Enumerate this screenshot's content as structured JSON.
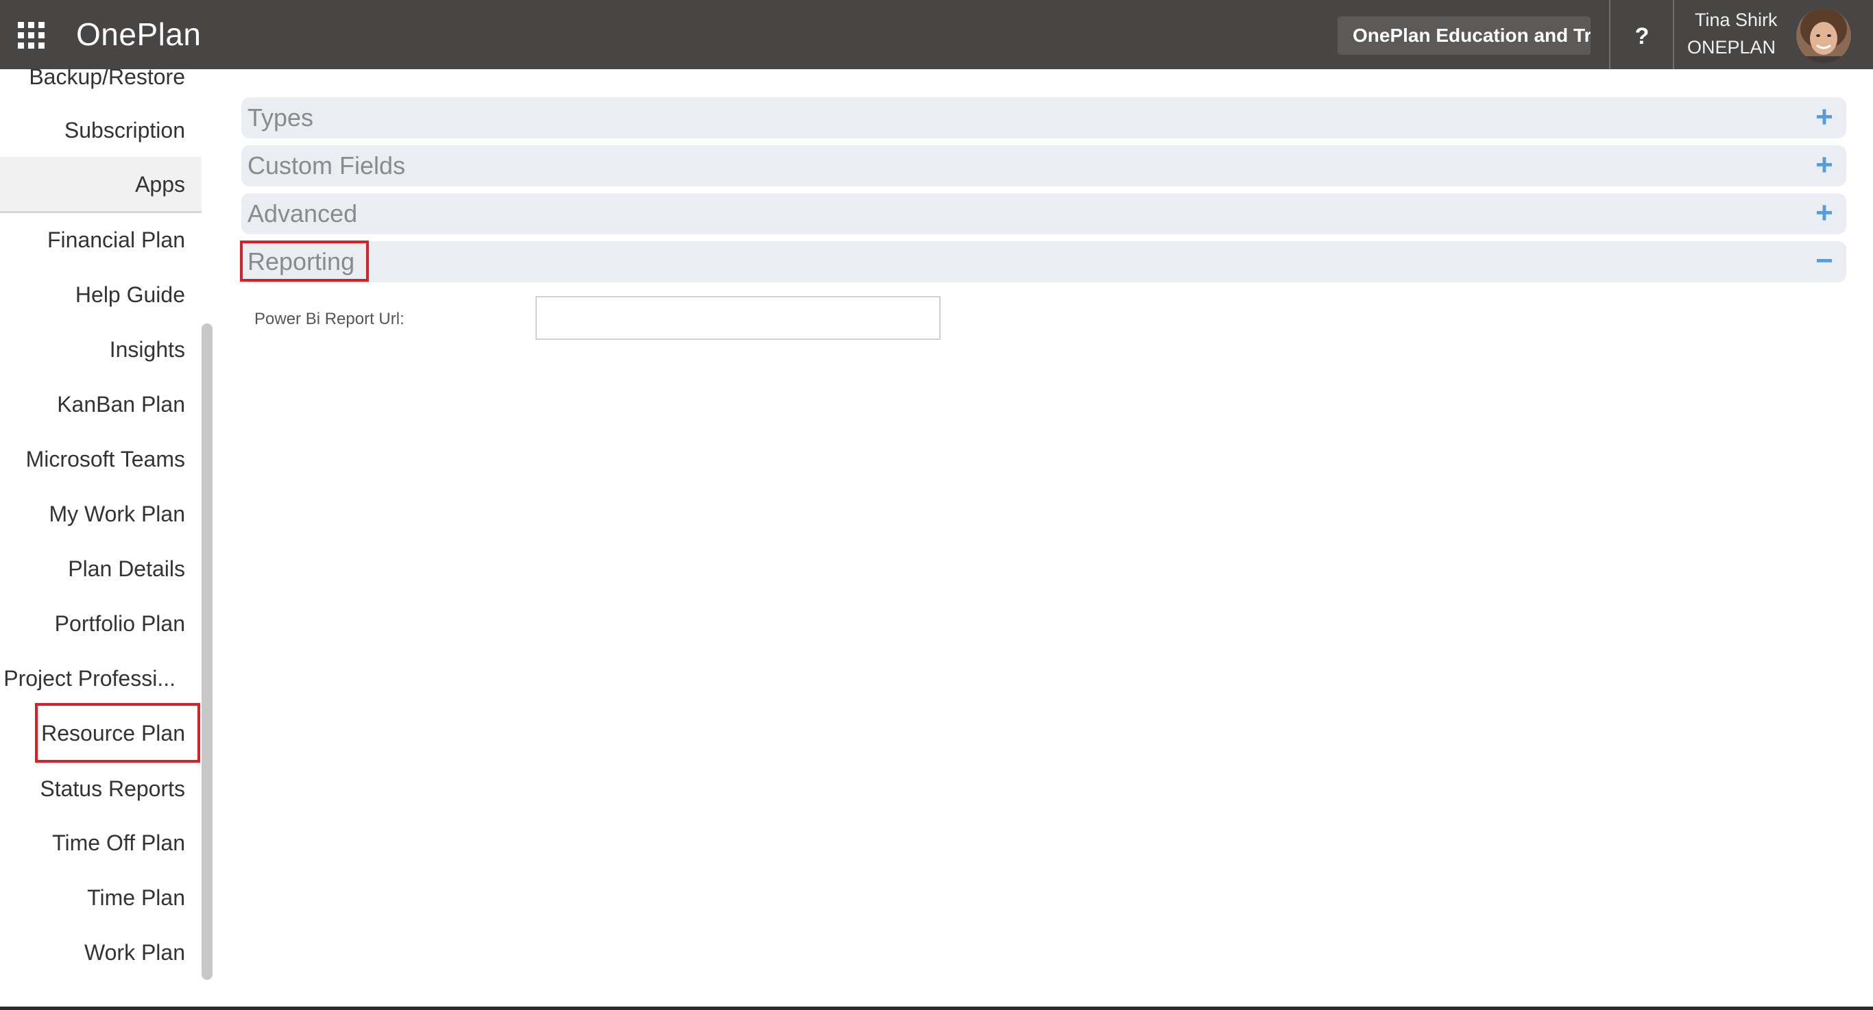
{
  "header": {
    "app_name": "OnePlan",
    "tenant": "OnePlan Education and Trai",
    "help": "?",
    "user_name": "Tina Shirk",
    "user_org": "ONEPLAN"
  },
  "sidebar": {
    "items": [
      {
        "label": "Backup/Restore"
      },
      {
        "label": "Subscription"
      },
      {
        "label": "Apps",
        "selected": true
      },
      {
        "label": "Financial Plan"
      },
      {
        "label": "Help Guide"
      },
      {
        "label": "Insights"
      },
      {
        "label": "KanBan Plan"
      },
      {
        "label": "Microsoft Teams"
      },
      {
        "label": "My Work Plan"
      },
      {
        "label": "Plan Details"
      },
      {
        "label": "Portfolio Plan"
      },
      {
        "label": "Project Professi..."
      },
      {
        "label": "Resource Plan",
        "highlighted": true
      },
      {
        "label": "Status Reports"
      },
      {
        "label": "Time Off Plan"
      },
      {
        "label": "Time Plan"
      },
      {
        "label": "Work Plan"
      }
    ]
  },
  "main": {
    "sections": [
      {
        "title": "Types",
        "toggle": "+"
      },
      {
        "title": "Custom Fields",
        "toggle": "+"
      },
      {
        "title": "Advanced",
        "toggle": "+"
      },
      {
        "title": "Reporting",
        "toggle": "−",
        "expanded": true
      }
    ],
    "reporting": {
      "power_bi_label": "Power Bi Report Url:",
      "power_bi_value": "",
      "power_bi_placeholder": ""
    }
  },
  "colors": {
    "topbar": "#474644",
    "accent": "#5a9bd5",
    "highlight": "#d81f2a",
    "section_bg": "#eaeef3"
  },
  "icons": [
    "waffle-icon",
    "help-icon",
    "plus-icon",
    "minus-icon"
  ]
}
